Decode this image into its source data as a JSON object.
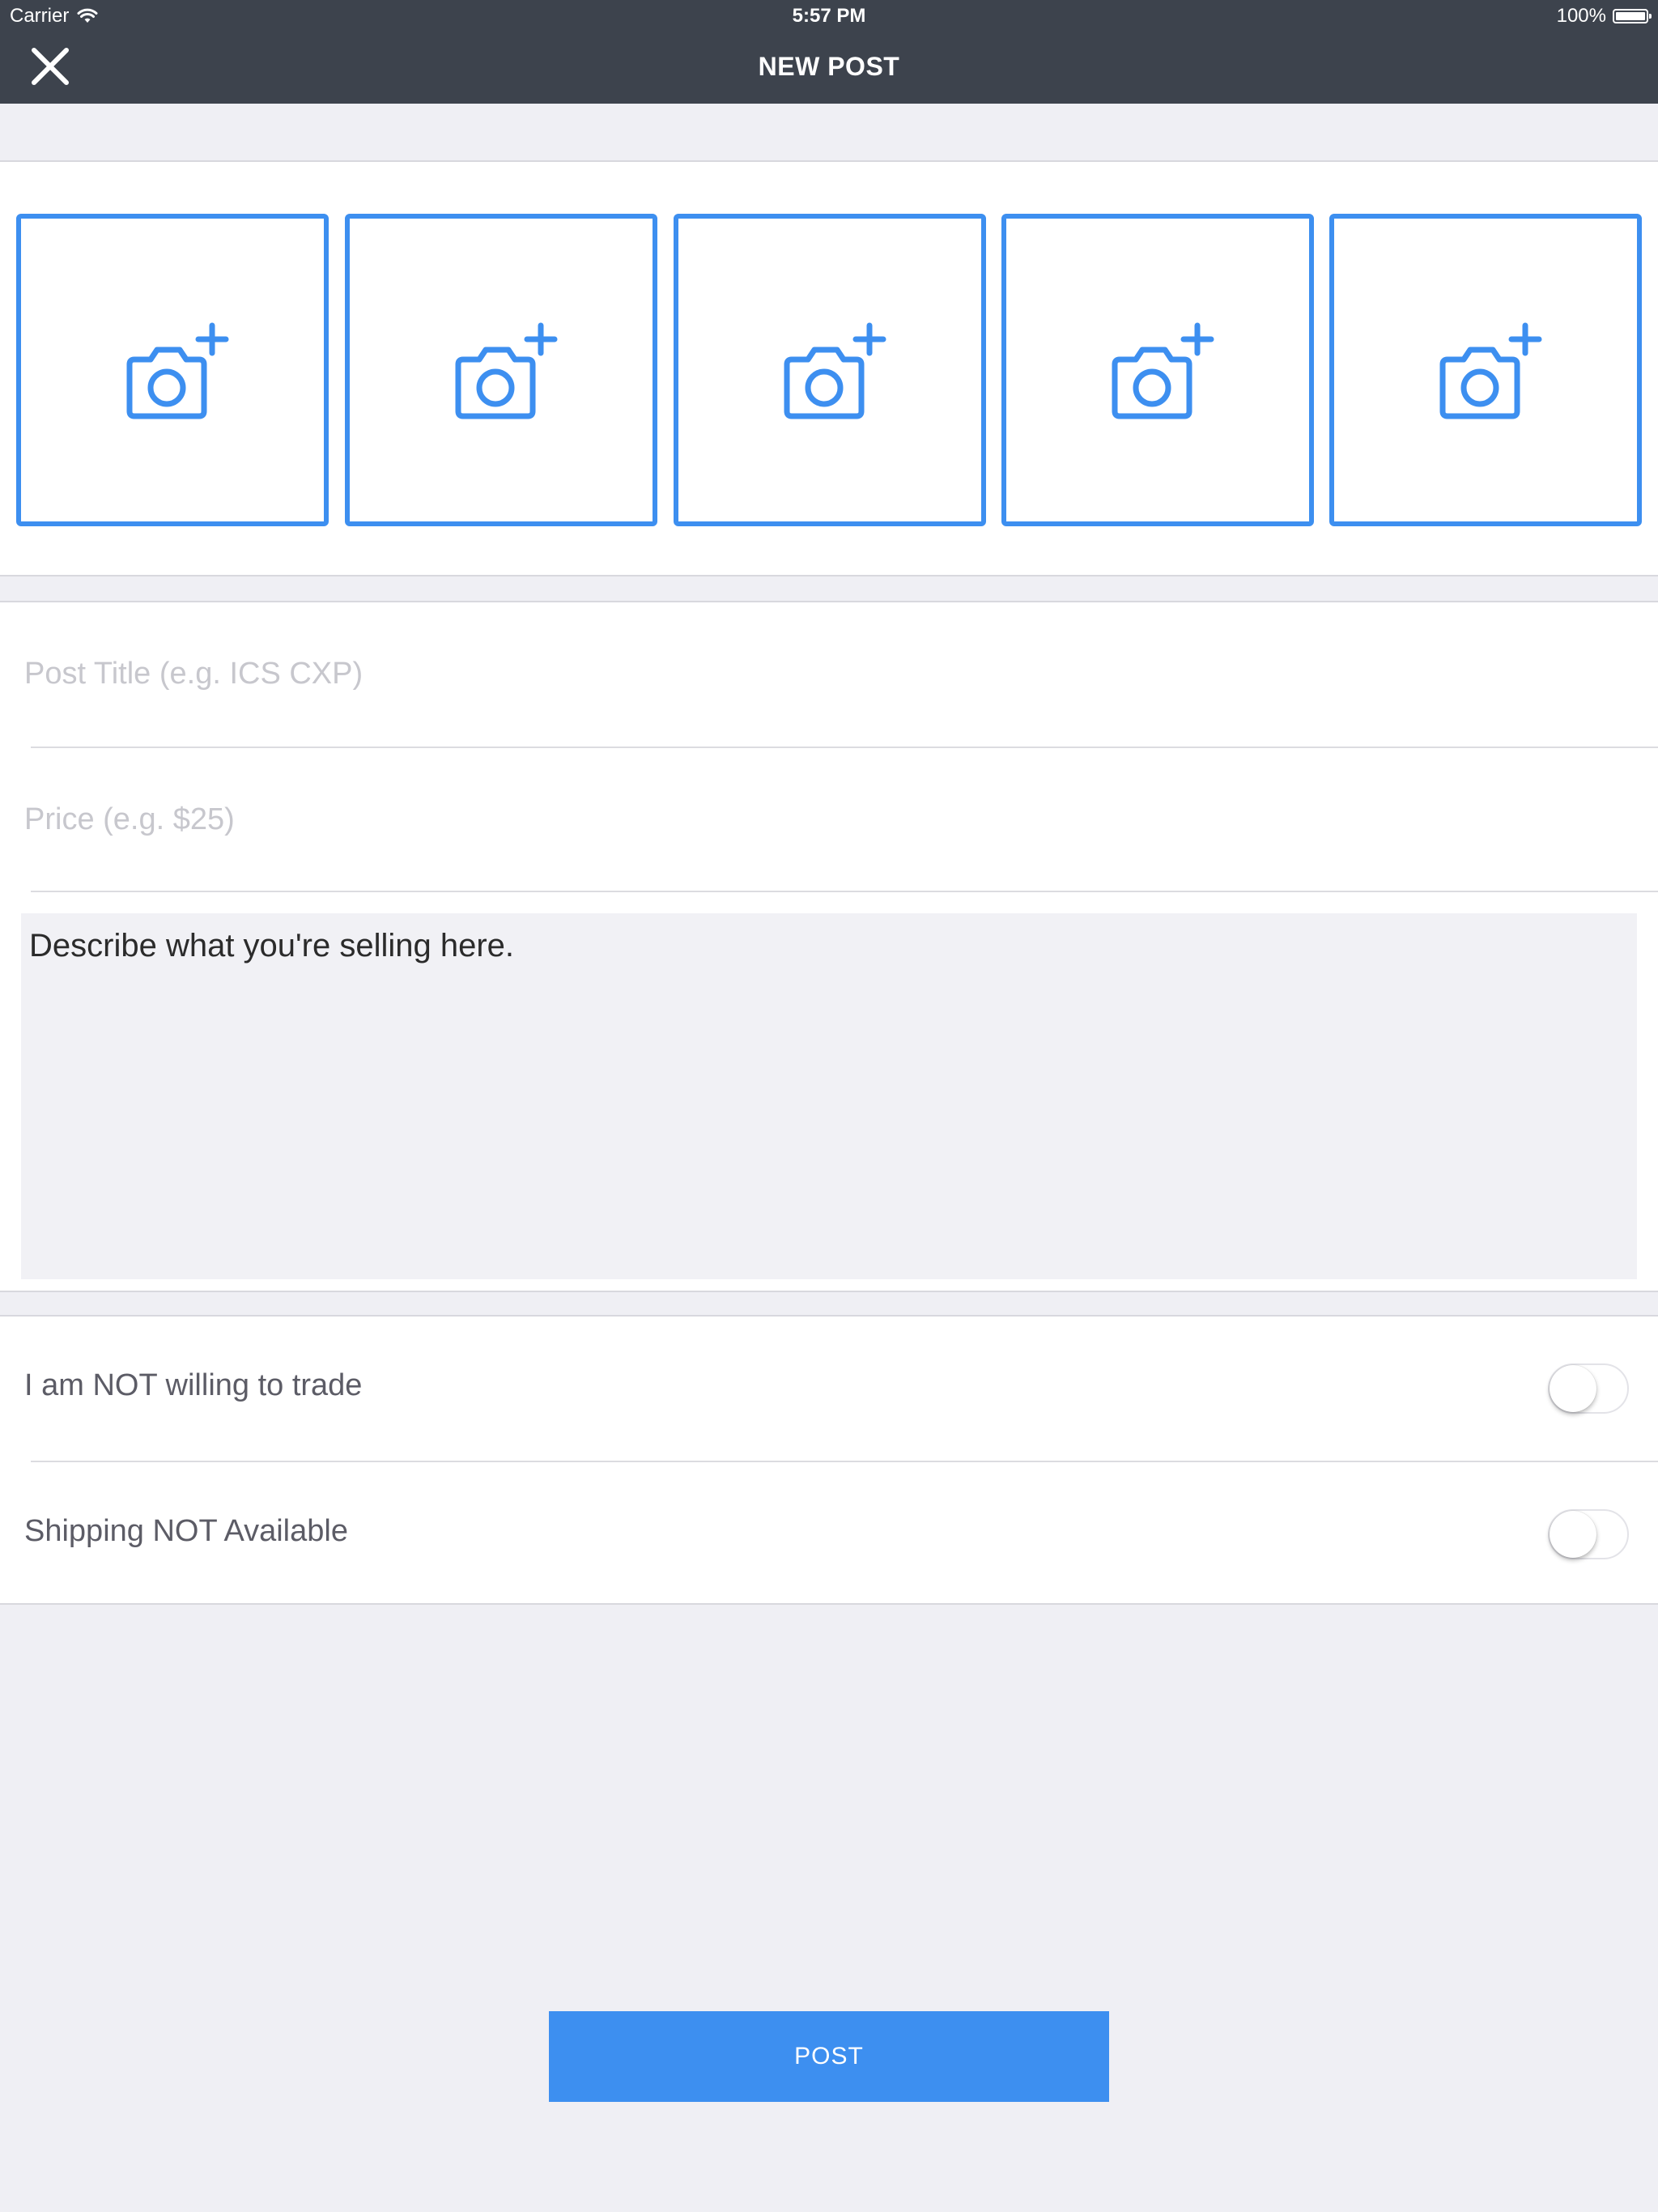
{
  "status_bar": {
    "carrier": "Carrier",
    "time": "5:57 PM",
    "battery": "100%"
  },
  "nav": {
    "title": "NEW POST",
    "close_icon": "close-icon"
  },
  "photos": {
    "slots": [
      {
        "icon": "add-photo-icon"
      },
      {
        "icon": "add-photo-icon"
      },
      {
        "icon": "add-photo-icon"
      },
      {
        "icon": "add-photo-icon"
      },
      {
        "icon": "add-photo-icon"
      }
    ],
    "accent_color": "#3d8ff0"
  },
  "form": {
    "title_field": {
      "value": "",
      "placeholder": "Post Title (e.g. ICS CXP)"
    },
    "price_field": {
      "value": "",
      "placeholder": "Price (e.g. $25)"
    },
    "description": {
      "value": "Describe what you're selling here."
    }
  },
  "toggles": [
    {
      "label": "I am NOT willing to trade",
      "on": false
    },
    {
      "label": "Shipping NOT Available",
      "on": false
    }
  ],
  "actions": {
    "post_label": "POST"
  },
  "colors": {
    "navbar": "#3d434d",
    "background": "#efeff4",
    "accent": "#3d8ff0"
  }
}
